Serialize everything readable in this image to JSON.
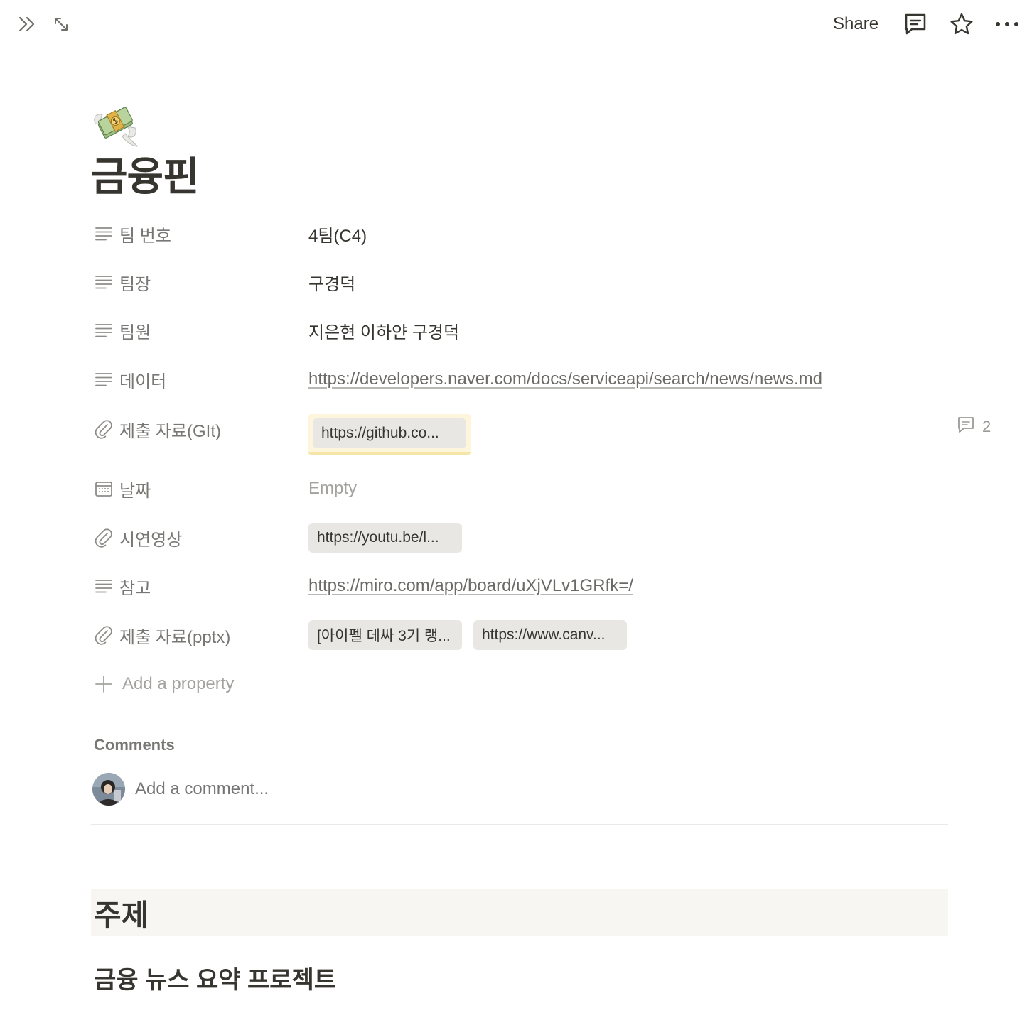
{
  "topbar": {
    "share_label": "Share",
    "icons": [
      "double-chevron-right-icon",
      "expand-icon",
      "comment-icon",
      "star-icon",
      "more-icon"
    ]
  },
  "page": {
    "icon": "money-with-wings-emoji",
    "title": "금융핀"
  },
  "properties": [
    {
      "icon": "text-lines-icon",
      "name": "팀 번호",
      "value": "4팀(C4)"
    },
    {
      "icon": "text-lines-icon",
      "name": "팀장",
      "value": "구경덕"
    },
    {
      "icon": "text-lines-icon",
      "name": "팀원",
      "value": "지은현 이하얀 구경덕"
    },
    {
      "icon": "text-lines-icon",
      "name": "데이터",
      "value": "https://developers.naver.com/docs/serviceapi/search/news/news.md"
    },
    {
      "icon": "paperclip-icon",
      "name": "제출 자료(GIt)",
      "chips": [
        "https://github.co..."
      ],
      "comment_count": "2"
    },
    {
      "icon": "calendar-icon",
      "name": "날짜",
      "value": "Empty"
    },
    {
      "icon": "paperclip-icon",
      "name": "시연영상",
      "chips": [
        "https://youtu.be/l..."
      ]
    },
    {
      "icon": "text-lines-icon",
      "name": "참고",
      "value": "https://miro.com/app/board/uXjVLv1GRfk=/"
    },
    {
      "icon": "paperclip-icon",
      "name": "제출 자료(pptx)",
      "chips": [
        "[아이펠 데싸 3기 랭...",
        "https://www.canv..."
      ]
    }
  ],
  "add_property_label": "Add a property",
  "comments": {
    "heading": "Comments",
    "placeholder": "Add a comment..."
  },
  "content": {
    "heading1": "주제",
    "heading2": "금융 뉴스 요약 프로젝트"
  }
}
